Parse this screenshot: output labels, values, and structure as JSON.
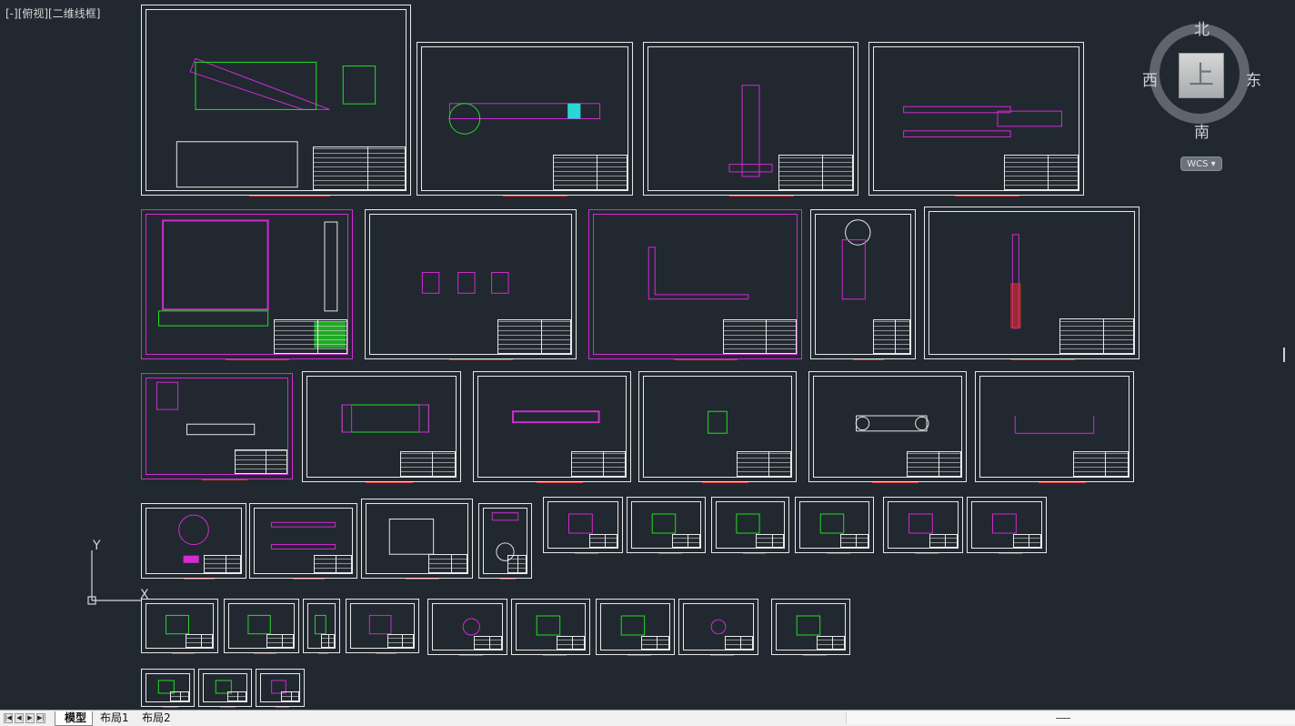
{
  "viewport": {
    "label": "[-][俯视][二维线框]"
  },
  "navcube": {
    "north": "北",
    "south": "南",
    "east": "东",
    "west": "西",
    "face": "上",
    "wcs_label": "WCS ▾"
  },
  "ucs": {
    "x_label": "X",
    "y_label": "Y"
  },
  "layout_tabs": [
    {
      "label": "模型",
      "active": true
    },
    {
      "label": "布局1",
      "active": false
    },
    {
      "label": "布局2",
      "active": false
    }
  ],
  "nav_buttons": [
    "|◀",
    "◀",
    "▶",
    "▶|"
  ],
  "colors": {
    "background": "#212830",
    "sheet_border": "#e8e8e8",
    "magenta": "#d22bd2",
    "green": "#22e022",
    "red": "#e23030",
    "cyan": "#29d6d6",
    "blue": "#3030e0"
  }
}
